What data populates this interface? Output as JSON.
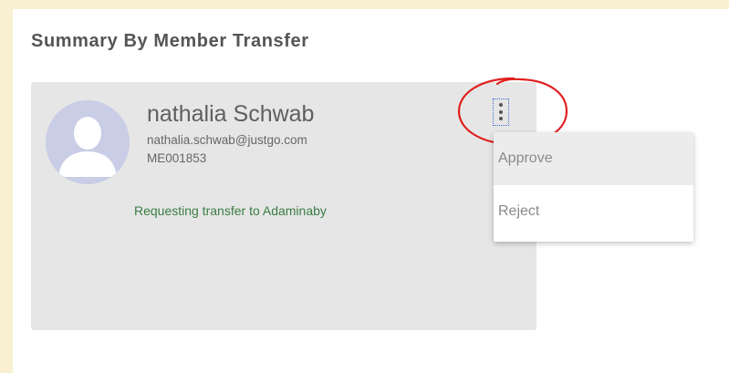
{
  "page": {
    "title": "Summary By Member Transfer"
  },
  "member": {
    "name": "nathalia Schwab",
    "email": "nathalia.schwab@justgo.com",
    "id": "ME001853",
    "status": "Requesting transfer to Adaminaby"
  },
  "menu": {
    "items": [
      {
        "label": "Approve"
      },
      {
        "label": "Reject"
      }
    ]
  },
  "icons": {
    "avatar": "user-silhouette-icon",
    "more": "vertical-ellipsis-icon"
  },
  "colors": {
    "page_background": "#f9f0d2",
    "card_background": "#e6e6e6",
    "status_text": "#3a7d44",
    "highlight": "#e02020",
    "avatar_background": "#c9cde6"
  }
}
